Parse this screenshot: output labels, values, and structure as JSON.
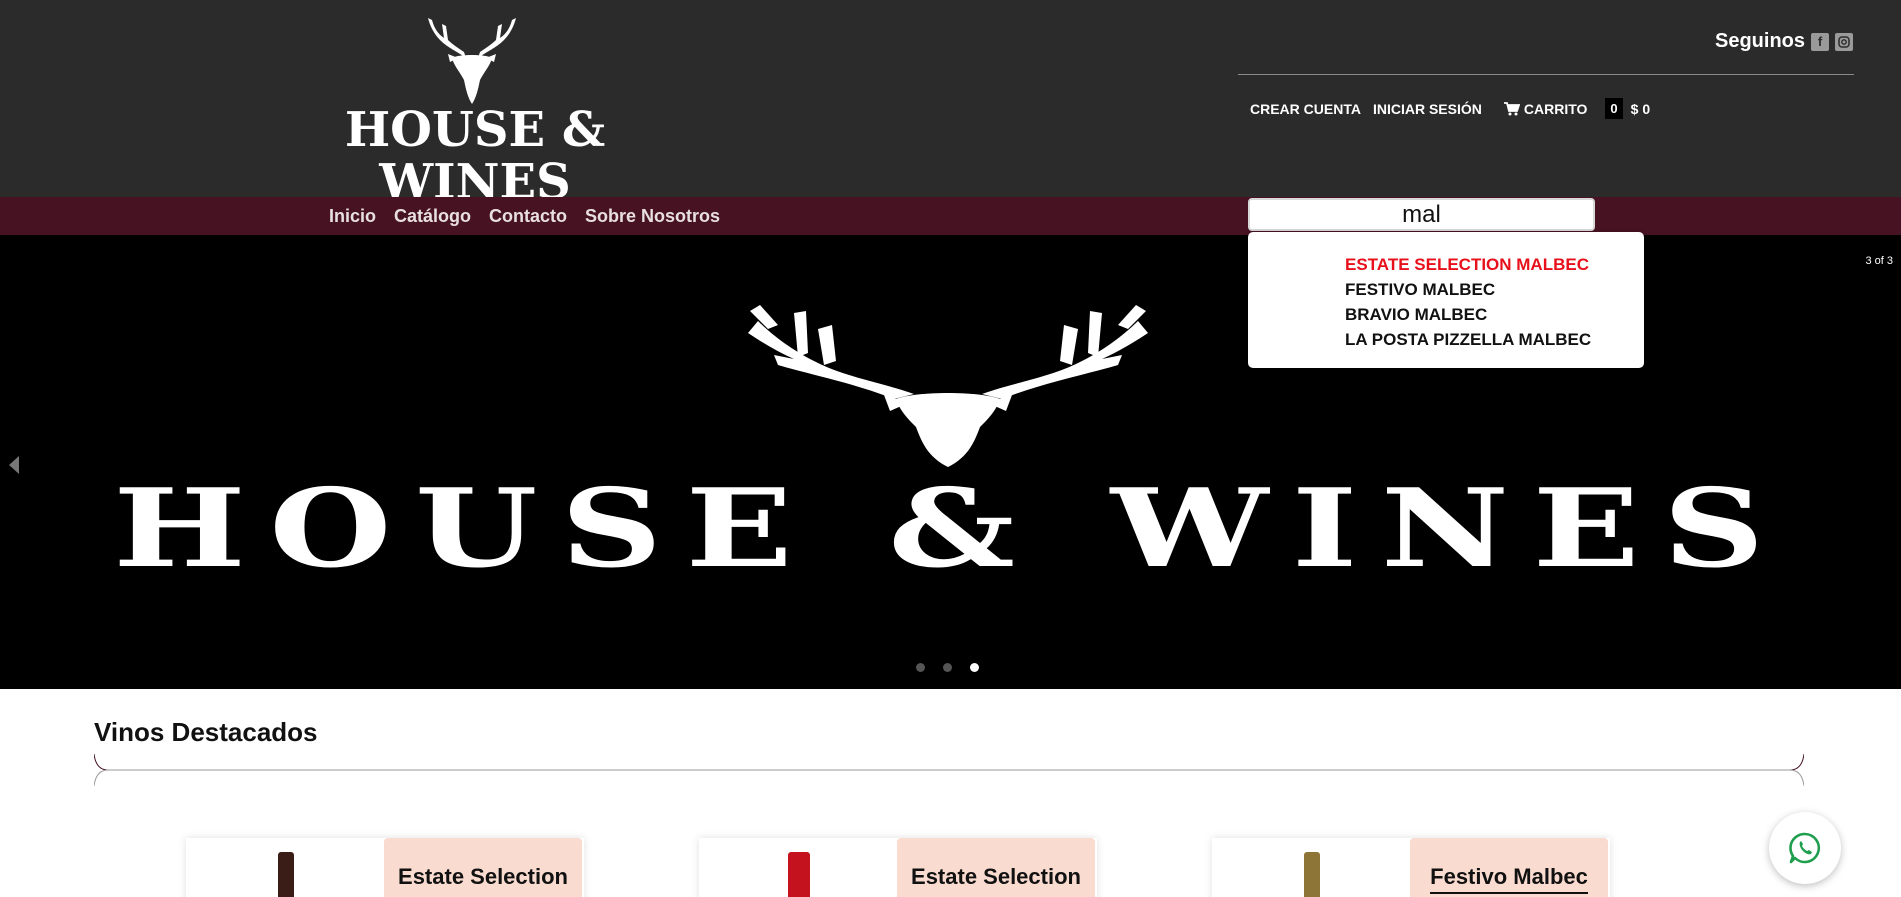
{
  "brand": {
    "logo_text": "HOUSE & WINES"
  },
  "header": {
    "follow_label": "Seguinos",
    "social": [
      "facebook-icon",
      "instagram-icon"
    ],
    "create_account": "CREAR CUENTA",
    "login": "INICIAR SESIÓN",
    "cart_label": "CARRITO",
    "cart_count": "0",
    "cart_total": "$ 0"
  },
  "nav": {
    "items": [
      "Inicio",
      "Catálogo",
      "Contacto",
      "Sobre Nosotros"
    ]
  },
  "search": {
    "value": "mal",
    "suggestions": [
      "ESTATE SELECTION MALBEC",
      "FESTIVO MALBEC",
      "BRAVIO MALBEC",
      "LA POSTA PIZZELLA MALBEC"
    ],
    "highlighted_index": 0
  },
  "hero": {
    "text": "HOUSE & WINES",
    "slide_counter": "3 of 3",
    "active_dot": 3,
    "dot_count": 3
  },
  "featured": {
    "title": "Vinos Destacados",
    "cards": [
      {
        "name_line": "Estate Selection",
        "bottle_color": "#3a1d16"
      },
      {
        "name_line": "Estate Selection",
        "bottle_color": "#c4121e"
      },
      {
        "name_line": "Festivo Malbec",
        "bottle_color": "#8d7437"
      }
    ]
  },
  "colors": {
    "header_bg": "#2b2b2b",
    "nav_bg": "#471221",
    "accent_red": "#e8111b",
    "tag_bg": "#fadbd0",
    "whatsapp": "#1f9e4d"
  }
}
